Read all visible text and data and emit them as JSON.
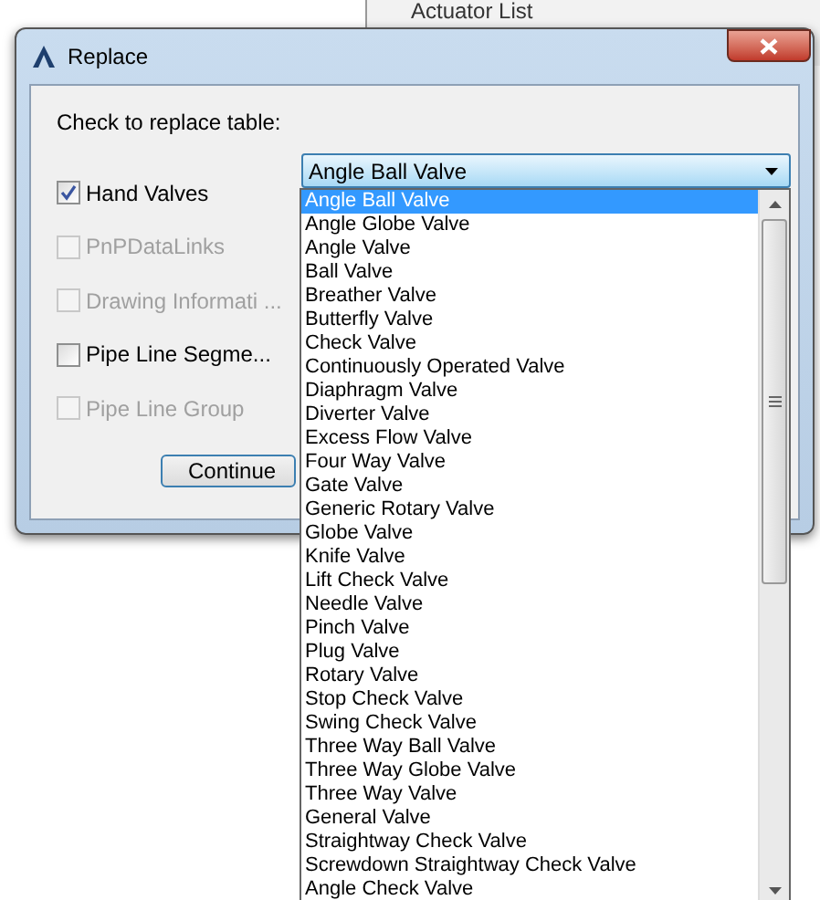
{
  "background_window": {
    "text": "Actuator List"
  },
  "window": {
    "title": "Replace"
  },
  "prompt": "Check to replace table:",
  "rows": [
    {
      "label": "Hand Valves",
      "checked": true,
      "disabled": false
    },
    {
      "label": "PnPDataLinks",
      "checked": false,
      "disabled": true
    },
    {
      "label": "Drawing Informati ...",
      "checked": false,
      "disabled": true
    },
    {
      "label": "Pipe Line Segme...",
      "checked": false,
      "disabled": false
    },
    {
      "label": "Pipe Line Group",
      "checked": false,
      "disabled": true
    }
  ],
  "combo": {
    "value": "Angle Ball Valve",
    "expanded": true
  },
  "options": [
    {
      "label": "Angle Ball Valve",
      "selected": true
    },
    {
      "label": "Angle Globe Valve",
      "selected": false
    },
    {
      "label": "Angle Valve",
      "selected": false
    },
    {
      "label": "Ball Valve",
      "selected": false
    },
    {
      "label": "Breather Valve",
      "selected": false
    },
    {
      "label": "Butterfly Valve",
      "selected": false
    },
    {
      "label": "Check Valve",
      "selected": false
    },
    {
      "label": "Continuously Operated Valve",
      "selected": false
    },
    {
      "label": "Diaphragm Valve",
      "selected": false
    },
    {
      "label": "Diverter Valve",
      "selected": false
    },
    {
      "label": "Excess Flow Valve",
      "selected": false
    },
    {
      "label": "Four Way Valve",
      "selected": false
    },
    {
      "label": "Gate Valve",
      "selected": false
    },
    {
      "label": "Generic Rotary Valve",
      "selected": false
    },
    {
      "label": "Globe Valve",
      "selected": false
    },
    {
      "label": "Knife Valve",
      "selected": false
    },
    {
      "label": "Lift Check Valve",
      "selected": false
    },
    {
      "label": "Needle Valve",
      "selected": false
    },
    {
      "label": "Pinch Valve",
      "selected": false
    },
    {
      "label": "Plug Valve",
      "selected": false
    },
    {
      "label": "Rotary Valve",
      "selected": false
    },
    {
      "label": "Stop Check Valve",
      "selected": false
    },
    {
      "label": "Swing Check Valve",
      "selected": false
    },
    {
      "label": "Three Way Ball Valve",
      "selected": false
    },
    {
      "label": "Three Way Globe Valve",
      "selected": false
    },
    {
      "label": "Three Way Valve",
      "selected": false
    },
    {
      "label": "General Valve",
      "selected": false
    },
    {
      "label": "Straightway Check Valve",
      "selected": false
    },
    {
      "label": "Screwdown Straightway Check Valve",
      "selected": false
    },
    {
      "label": "Angle Check Valve",
      "selected": false
    }
  ],
  "continue_button": "Continue"
}
